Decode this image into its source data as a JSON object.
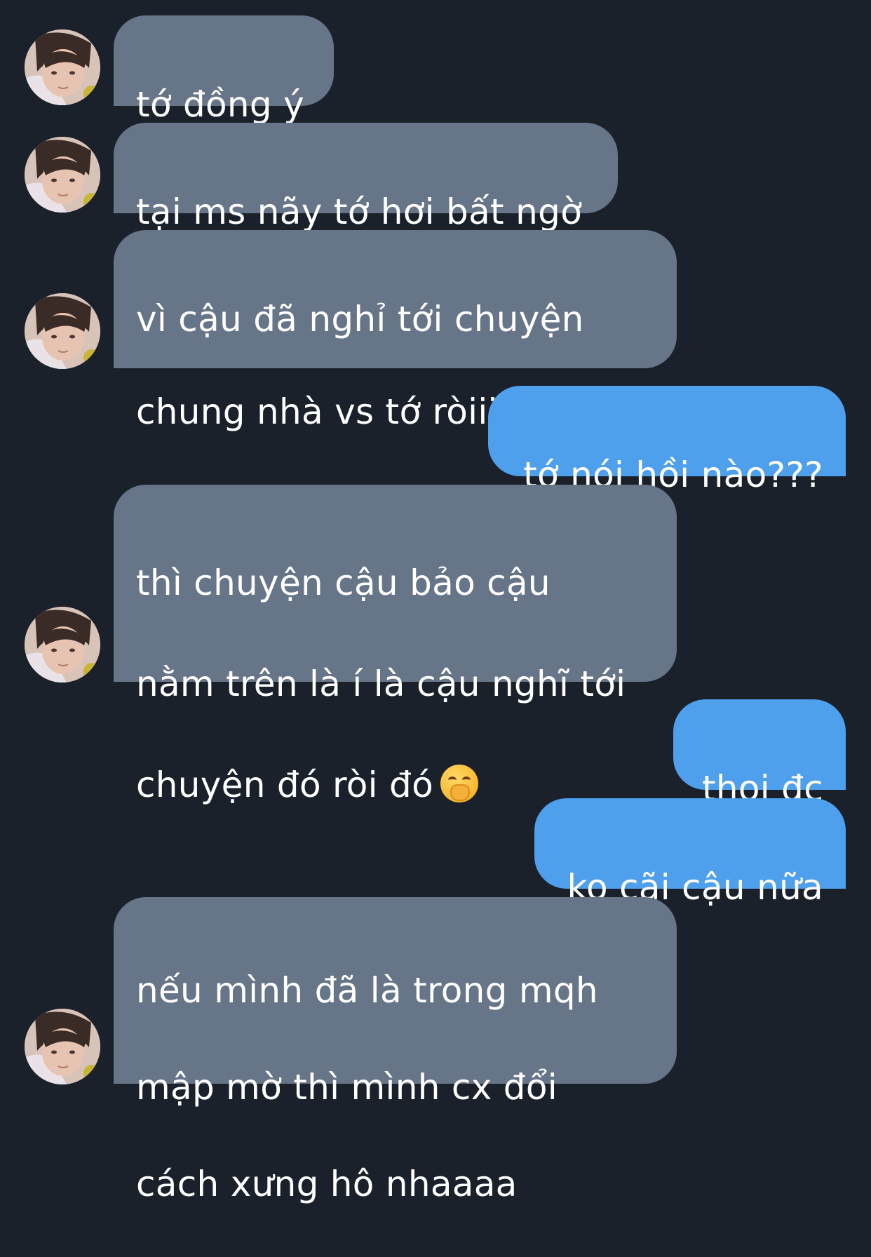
{
  "conversation": {
    "messages": [
      {
        "direction": "incoming",
        "lines": [
          "tớ đồng ý"
        ]
      },
      {
        "direction": "incoming",
        "lines": [
          "tại ms nãy tớ hơi bất ngờ"
        ]
      },
      {
        "direction": "incoming",
        "lines": [
          "vì cậu đã nghỉ tới chuyện",
          "chung nhà vs tớ ròiiii"
        ]
      },
      {
        "direction": "outgoing",
        "lines": [
          "tớ nói hồi nào???"
        ]
      },
      {
        "direction": "incoming",
        "lines": [
          "thì chuyện cậu bảo cậu",
          "nằm trên là í là cậu nghĩ tới",
          "chuyện đó ròi đó"
        ],
        "emoji": "hand-over-mouth-emoji"
      },
      {
        "direction": "outgoing",
        "lines": [
          "thoi đc"
        ]
      },
      {
        "direction": "outgoing",
        "lines": [
          "ko cãi cậu nữa"
        ]
      },
      {
        "direction": "incoming",
        "lines": [
          "nếu mình đã là trong mqh",
          "mập mờ thì mình cx đổi",
          "cách xưng hô nhaaaa"
        ]
      }
    ]
  },
  "colors": {
    "background": "#1a212b",
    "incoming_bubble": "#667587",
    "outgoing_bubble": "#4e9fec",
    "text": "#ffffff"
  },
  "icons": {
    "avatar": "contact-avatar-photo",
    "emoji": "hand-over-mouth-emoji"
  }
}
